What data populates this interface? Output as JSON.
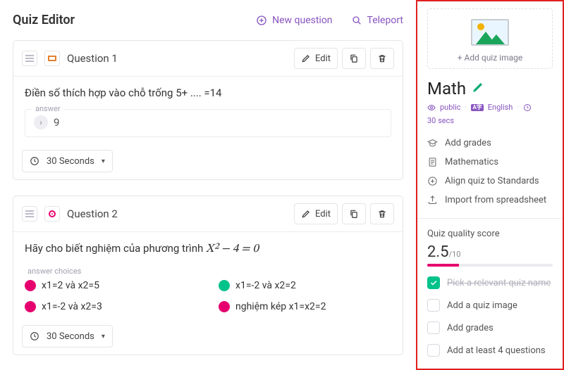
{
  "header": {
    "title": "Quiz Editor",
    "new_question": "New question",
    "teleport": "Teleport"
  },
  "questions": [
    {
      "title": "Question 1",
      "edit_label": "Edit",
      "body": "Điền số thích hợp vào chỗ trống 5+ .... =14",
      "answer_label": "answer",
      "answer_value": "9",
      "time_label": "30 Seconds"
    },
    {
      "title": "Question 2",
      "edit_label": "Edit",
      "body_prefix": "Hãy cho biết nghiệm của phương trình ",
      "body_math": "X² − 4 = 0",
      "choices_label": "answer choices",
      "choices": [
        {
          "text": "x1=2 và x2=5",
          "correct": false
        },
        {
          "text": "x1=-2 và x2=2",
          "correct": true
        },
        {
          "text": "x1=-2 và x2=3",
          "correct": false
        },
        {
          "text": "nghiệm kép x1=x2=2",
          "correct": false
        }
      ],
      "time_label": "30 Seconds"
    }
  ],
  "sidebar": {
    "add_image": "+ Add quiz image",
    "quiz_name": "Math",
    "visibility": "public",
    "language": "English",
    "duration": "30 secs",
    "actions": {
      "grades": "Add grades",
      "subject": "Mathematics",
      "standards": "Align quiz to Standards",
      "import": "Import from spreadsheet"
    },
    "quality": {
      "label": "Quiz quality score",
      "score": "2.5",
      "max": "/10",
      "percent": 25
    },
    "checklist": [
      {
        "text": "Pick a relevant quiz name",
        "done": true
      },
      {
        "text": "Add a quiz image",
        "done": false
      },
      {
        "text": "Add grades",
        "done": false
      },
      {
        "text": "Add at least 4 questions",
        "done": false
      }
    ]
  }
}
